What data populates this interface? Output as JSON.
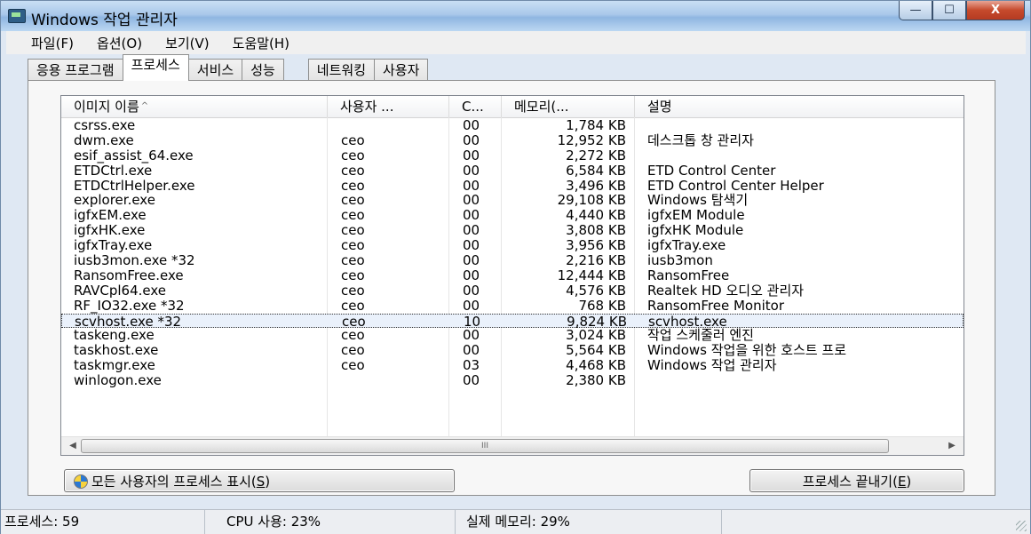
{
  "window": {
    "title": "Windows 작업 관리자",
    "buttons": {
      "minimize": "—",
      "maximize": "☐",
      "close": "X"
    }
  },
  "menu": [
    "파일(F)",
    "옵션(O)",
    "보기(V)",
    "도움말(H)"
  ],
  "tabs": [
    "응용 프로그램",
    "프로세스",
    "서비스",
    "성능",
    "네트워킹",
    "사용자"
  ],
  "active_tab": "프로세스",
  "table": {
    "columns": [
      "이미지 이름",
      "사용자 ...",
      "C...",
      "메모리(...",
      "설명"
    ],
    "rows": [
      {
        "name": "csrss.exe",
        "user": "",
        "cpu": "00",
        "mem": "1,784 KB",
        "desc": ""
      },
      {
        "name": "dwm.exe",
        "user": "ceo",
        "cpu": "00",
        "mem": "12,952 KB",
        "desc": "데스크톱 창 관리자"
      },
      {
        "name": "esif_assist_64.exe",
        "user": "ceo",
        "cpu": "00",
        "mem": "2,272 KB",
        "desc": ""
      },
      {
        "name": "ETDCtrl.exe",
        "user": "ceo",
        "cpu": "00",
        "mem": "6,584 KB",
        "desc": "ETD Control Center"
      },
      {
        "name": "ETDCtrlHelper.exe",
        "user": "ceo",
        "cpu": "00",
        "mem": "3,496 KB",
        "desc": "ETD Control Center Helper"
      },
      {
        "name": "explorer.exe",
        "user": "ceo",
        "cpu": "00",
        "mem": "29,108 KB",
        "desc": "Windows 탐색기"
      },
      {
        "name": "igfxEM.exe",
        "user": "ceo",
        "cpu": "00",
        "mem": "4,440 KB",
        "desc": "igfxEM Module"
      },
      {
        "name": "igfxHK.exe",
        "user": "ceo",
        "cpu": "00",
        "mem": "3,808 KB",
        "desc": "igfxHK Module"
      },
      {
        "name": "igfxTray.exe",
        "user": "ceo",
        "cpu": "00",
        "mem": "3,956 KB",
        "desc": "igfxTray.exe"
      },
      {
        "name": "iusb3mon.exe *32",
        "user": "ceo",
        "cpu": "00",
        "mem": "2,216 KB",
        "desc": "iusb3mon"
      },
      {
        "name": "RansomFree.exe",
        "user": "ceo",
        "cpu": "00",
        "mem": "12,444 KB",
        "desc": "RansomFree"
      },
      {
        "name": "RAVCpl64.exe",
        "user": "ceo",
        "cpu": "00",
        "mem": "4,576 KB",
        "desc": "Realtek HD 오디오 관리자"
      },
      {
        "name": "RF_IO32.exe *32",
        "user": "ceo",
        "cpu": "00",
        "mem": "768 KB",
        "desc": "RansomFree Monitor"
      },
      {
        "name": "scvhost.exe *32",
        "user": "ceo",
        "cpu": "10",
        "mem": "9,824 KB",
        "desc": "scvhost.exe",
        "selected": true
      },
      {
        "name": "taskeng.exe",
        "user": "ceo",
        "cpu": "00",
        "mem": "3,024 KB",
        "desc": "작업 스케줄러 엔진"
      },
      {
        "name": "taskhost.exe",
        "user": "ceo",
        "cpu": "00",
        "mem": "5,564 KB",
        "desc": "Windows 작업을 위한 호스트 프로"
      },
      {
        "name": "taskmgr.exe",
        "user": "ceo",
        "cpu": "03",
        "mem": "4,468 KB",
        "desc": "Windows 작업 관리자"
      },
      {
        "name": "winlogon.exe",
        "user": "",
        "cpu": "00",
        "mem": "2,380 KB",
        "desc": ""
      }
    ]
  },
  "scrollbar": {
    "thumb_label": "III"
  },
  "buttons": {
    "show_all_pre": "모든 사용자의 프로세스 표시(",
    "show_all_key": "S",
    "show_all_post": ")",
    "end_pre": "프로세스 끝내기(",
    "end_key": "E",
    "end_post": ")"
  },
  "status": {
    "processes": "프로세스: 59",
    "cpu": "CPU 사용: 23%",
    "memory": "실제 메모리: 29%"
  }
}
